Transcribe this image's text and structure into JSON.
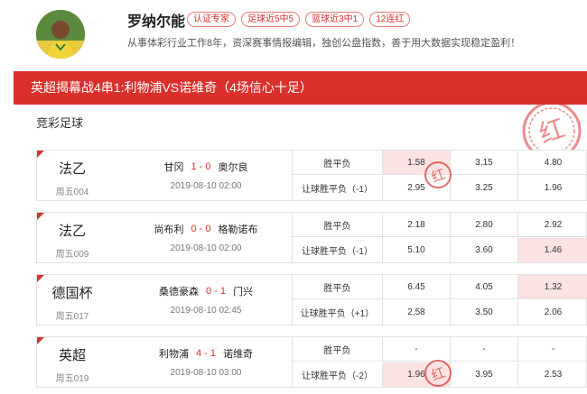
{
  "expert": {
    "name": "罗纳尔能",
    "tags": [
      "认证专家",
      "足球近5中5",
      "篮球近3中1",
      "12连红"
    ],
    "description": "从事体彩行业工作8年，资深赛事情报编辑，独创公盘指数，善于用大数据实现稳定盈利！"
  },
  "banner": {
    "title": "英超揭幕战4串1:利物浦VS诺维奇（4场信心十足）"
  },
  "section": {
    "label": "竞彩足球"
  },
  "stamp_char": "红",
  "colors": {
    "accent": "#d9302c",
    "hit": "#fbe3e3"
  },
  "matches": [
    {
      "league": "法乙",
      "issue": "周五004",
      "home": "甘冈",
      "score": "1 - 0",
      "away": "奥尔良",
      "time": "2019-08-10 02:00",
      "row1": {
        "type": "胜平负",
        "odds": [
          "1.58",
          "3.15",
          "4.80"
        ],
        "hit": 0
      },
      "row2": {
        "type": "让球胜平负（-1）",
        "odds": [
          "2.95",
          "3.25",
          "1.96"
        ],
        "hit": -1
      }
    },
    {
      "league": "法乙",
      "issue": "周五009",
      "home": "尚布利",
      "score": "0 - 0",
      "away": "格勒诺布",
      "time": "2019-08-10 02:00",
      "row1": {
        "type": "胜平负",
        "odds": [
          "2.18",
          "2.80",
          "2.92"
        ],
        "hit": -1
      },
      "row2": {
        "type": "让球胜平负（-1）",
        "odds": [
          "5.10",
          "3.60",
          "1.46"
        ],
        "hit": 2
      }
    },
    {
      "league": "德国杯",
      "issue": "周五017",
      "home": "桑德豪森",
      "score": "0 - 1",
      "away": "门兴",
      "time": "2019-08-10 02:45",
      "row1": {
        "type": "胜平负",
        "odds": [
          "6.45",
          "4.05",
          "1.32"
        ],
        "hit": 2
      },
      "row2": {
        "type": "让球胜平负（+1）",
        "odds": [
          "2.58",
          "3.50",
          "2.06"
        ],
        "hit": -1
      }
    },
    {
      "league": "英超",
      "issue": "周五019",
      "home": "利物浦",
      "score": "4 - 1",
      "away": "诺维奇",
      "time": "2019-08-10 03:00",
      "row1": {
        "type": "胜平负",
        "odds": [
          "-",
          "-",
          "-"
        ],
        "hit": -1
      },
      "row2": {
        "type": "让球胜平负（-2）",
        "odds": [
          "1.96",
          "3.95",
          "2.53"
        ],
        "hit": 0
      }
    }
  ]
}
